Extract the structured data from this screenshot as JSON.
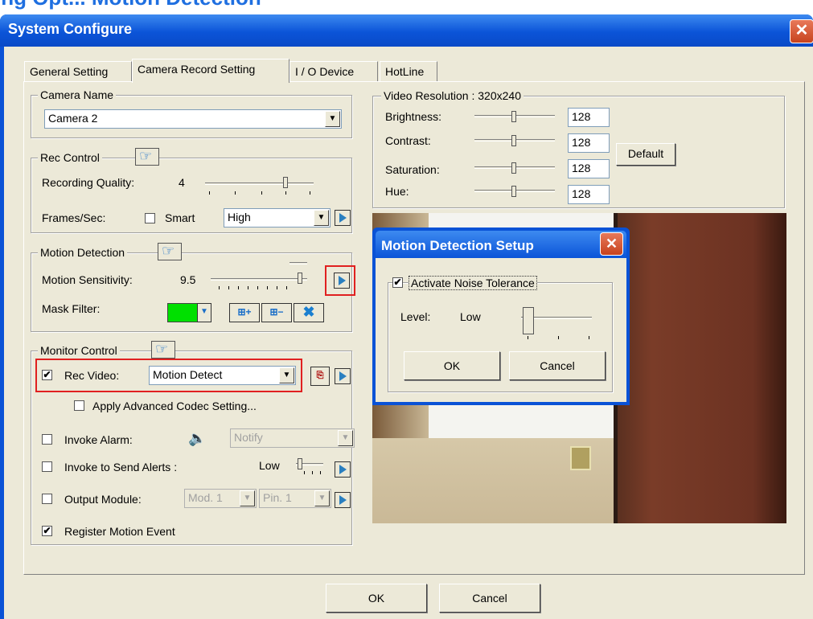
{
  "heading": "ing Opt... Motion Detection",
  "window": {
    "title": "System Configure",
    "close": "✕"
  },
  "tabs": [
    {
      "label": "General Setting",
      "active": false
    },
    {
      "label": "Camera Record Setting",
      "active": true
    },
    {
      "label": "I / O Device",
      "active": false
    },
    {
      "label": "HotLine",
      "active": false
    }
  ],
  "camera": {
    "group": "Camera Name",
    "value": "Camera 2"
  },
  "rec_control": {
    "group": "Rec Control",
    "quality_label": "Recording Quality:",
    "quality_value": "4",
    "fps_label": "Frames/Sec:",
    "smart_label": "Smart",
    "smart_checked": false,
    "fps_value": "High"
  },
  "motion": {
    "group": "Motion Detection",
    "sensitivity_label": "Motion Sensitivity:",
    "sensitivity_value": "9.5",
    "mask_label": "Mask Filter:",
    "mask_color": "#00e000"
  },
  "monitor": {
    "group": "Monitor Control",
    "rec_video_label": "Rec Video:",
    "rec_video_checked": true,
    "rec_video_value": "Motion Detect",
    "advanced_label": "Apply Advanced Codec Setting...",
    "advanced_checked": false,
    "alarm_label": "Invoke Alarm:",
    "alarm_checked": false,
    "alarm_value": "Notify",
    "alerts_label": "Invoke to Send Alerts :",
    "alerts_checked": false,
    "alerts_level": "Low",
    "output_label": "Output Module:",
    "output_checked": false,
    "output_mod": "Mod. 1",
    "output_pin": "Pin. 1",
    "register_label": "Register Motion Event",
    "register_checked": true
  },
  "video": {
    "group": "Video Resolution : 320x240",
    "brightness_label": "Brightness:",
    "brightness_value": "128",
    "contrast_label": "Contrast:",
    "contrast_value": "128",
    "saturation_label": "Saturation:",
    "saturation_value": "128",
    "hue_label": "Hue:",
    "hue_value": "128",
    "default_label": "Default"
  },
  "subdialog": {
    "title": "Motion Detection Setup",
    "close": "✕",
    "noise_label": "Activate Noise Tolerance",
    "noise_checked": true,
    "level_label": "Level:",
    "level_value": "Low",
    "ok_label": "OK",
    "cancel_label": "Cancel"
  },
  "footer": {
    "ok_label": "OK",
    "cancel_label": "Cancel"
  },
  "check_mark": "✔",
  "colors": {
    "titlebar": "#0b54d8",
    "highlight": "#e02020",
    "heading": "#1f6fe0"
  }
}
